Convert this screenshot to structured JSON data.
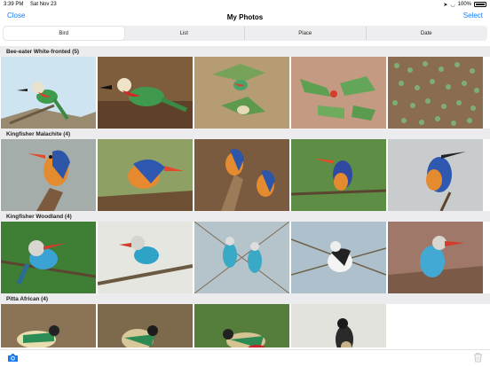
{
  "status": {
    "time": "3:39 PM",
    "date": "Sat Nov 23",
    "battery": "100%"
  },
  "nav": {
    "close_label": "Close",
    "title": "My Photos",
    "select_label": "Select"
  },
  "segments": {
    "bird": "Bird",
    "list": "List",
    "place": "Place",
    "date": "Date",
    "selected": "Bird"
  },
  "colors": {
    "accent": "#1a7cf5",
    "section_bg": "#ececee"
  },
  "sections": [
    {
      "title": "Bee-eater White-fronted (5)",
      "photos": [
        "bee-eater-perched-on-branch",
        "bee-eater-on-ground",
        "bee-eaters-in-flight",
        "bee-eaters-group-on-ground",
        "bee-eater-flock-on-ground"
      ]
    },
    {
      "title": "Kingfisher Malachite (4)",
      "photos": [
        "malachite-kingfisher-on-stick",
        "malachite-kingfisher-on-log",
        "malachite-kingfisher-pair",
        "malachite-kingfisher-on-twig",
        "malachite-kingfisher-closeup"
      ]
    },
    {
      "title": "Kingfisher Woodland (4)",
      "photos": [
        "woodland-kingfisher-green-background",
        "woodland-kingfisher-on-branch",
        "woodland-kingfishers-in-thorns",
        "kingfisher-pied-in-thorns",
        "woodland-kingfisher-brown-background"
      ]
    },
    {
      "title": "Pitta African (4)",
      "photos": [
        "african-pitta-on-ground",
        "african-pitta-in-leaves",
        "african-pitta-red-belly",
        "african-pitta-dark"
      ]
    }
  ],
  "toolbar": {
    "camera_icon": "camera-icon",
    "trash_icon": "trash-icon"
  }
}
